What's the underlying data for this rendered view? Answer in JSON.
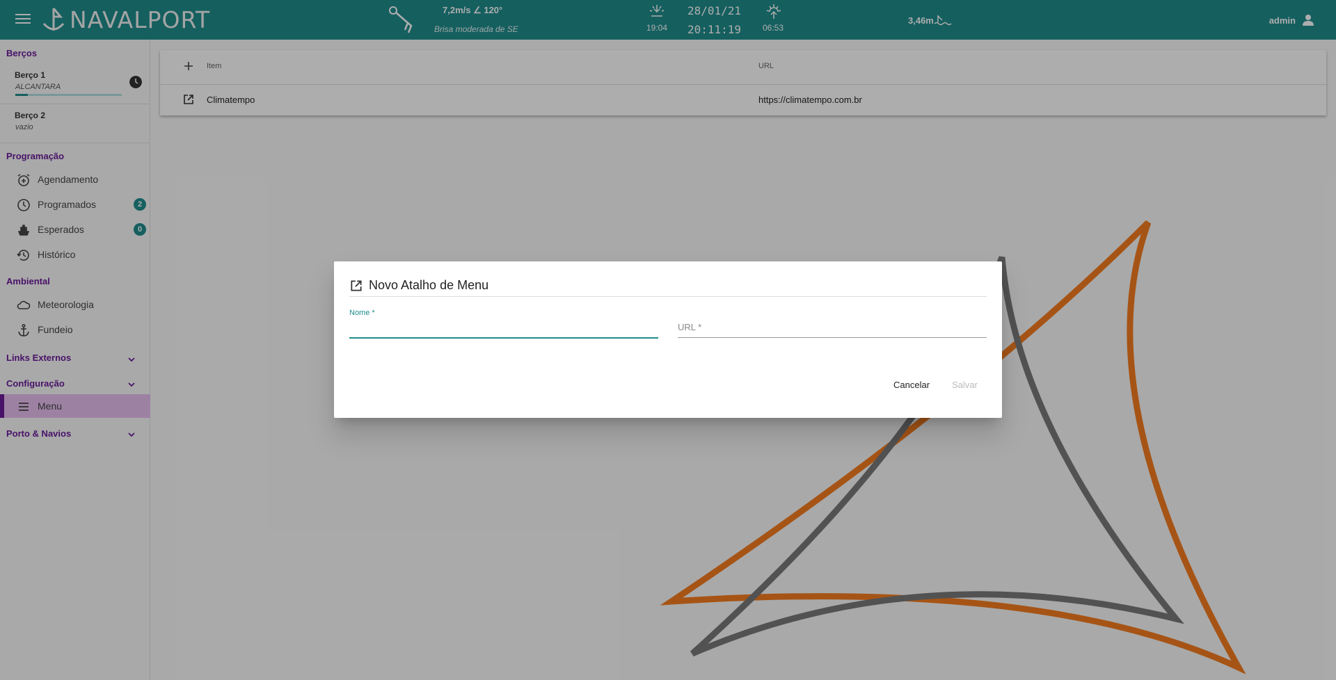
{
  "header": {
    "app_name": "NAVALPORT",
    "wind_speed": "7,2m/s ∠ 120°",
    "wind_desc": "Brisa moderada de SE",
    "sunset_time": "19:04",
    "date": "28/01/21",
    "time": "20:11:19",
    "sunrise_time": "06:53",
    "tide": "3,46m",
    "user": "admin",
    "accent": "#1f8c8c"
  },
  "sidebar": {
    "bercos_title": "Berços",
    "berco1": {
      "name": "Berço 1",
      "sub": "ALCANTARA",
      "progress": 0.12
    },
    "berco2": {
      "name": "Berço 2",
      "sub": "vazio"
    },
    "programacao_title": "Programação",
    "agendamento": "Agendamento",
    "programados": "Programados",
    "programados_count": "2",
    "esperados": "Esperados",
    "esperados_count": "0",
    "historico": "Histórico",
    "ambiental_title": "Ambiental",
    "meteorologia": "Meteorologia",
    "fundeio": "Fundeio",
    "links_externos": "Links Externos",
    "configuracao": "Configuração",
    "menu": "Menu",
    "porto_navios": "Porto & Navios"
  },
  "table": {
    "col_item": "Item",
    "col_url": "URL",
    "rows": [
      {
        "item": "Climatempo",
        "url": "https://climatempo.com.br"
      }
    ]
  },
  "dialog": {
    "title": "Novo Atalho de Menu",
    "name_label": "Nome *",
    "url_label": "URL *",
    "cancel": "Cancelar",
    "save": "Salvar"
  }
}
